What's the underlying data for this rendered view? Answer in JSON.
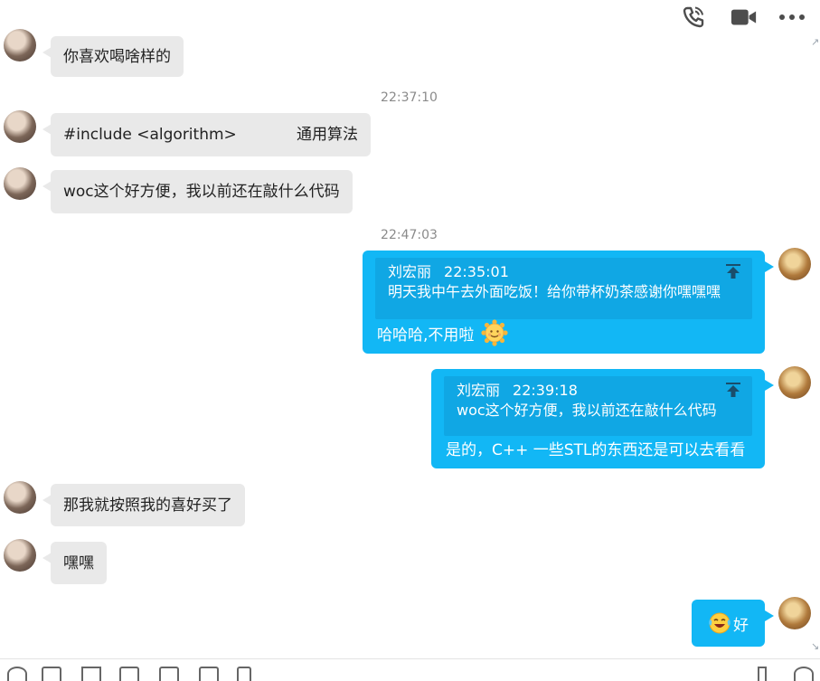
{
  "messages": {
    "m1": {
      "text": "你喜欢喝啥样的"
    },
    "t1": {
      "text": "22:37:10"
    },
    "m2": {
      "code": "#include <algorithm>",
      "comment": "通用算法"
    },
    "m3": {
      "text": "woc这个好方便，我以前还在敲什么代码"
    },
    "t2": {
      "text": "22:47:03"
    },
    "r1": {
      "quote_name": "刘宏丽",
      "quote_time": "22:35:01",
      "quote_text": "明天我中午去外面吃饭！给你带杯奶茶感谢你嘿嘿嘿",
      "reply": "哈哈哈,不用啦",
      "reply_emoji": "sun-emoji"
    },
    "r2": {
      "quote_name": "刘宏丽",
      "quote_time": "22:39:18",
      "quote_text": "woc这个好方便，我以前还在敲什么代码",
      "reply": "是的，C++ 一些STL的东西还是可以去看看"
    },
    "m4": {
      "text": "那我就按照我的喜好买了"
    },
    "m5": {
      "text": "嘿嘿"
    },
    "r3": {
      "reply": "好",
      "reply_emoji": "laugh-cry-emoji"
    }
  },
  "toolbar_icons": [
    "phone-icon",
    "video-call-icon",
    "more-options-icon"
  ],
  "colors": {
    "sent_bubble": "#12b7f5",
    "quote_bg": "#10a7e4",
    "received_bubble": "#e9e9e9",
    "timestamp": "#8a8a8a"
  }
}
